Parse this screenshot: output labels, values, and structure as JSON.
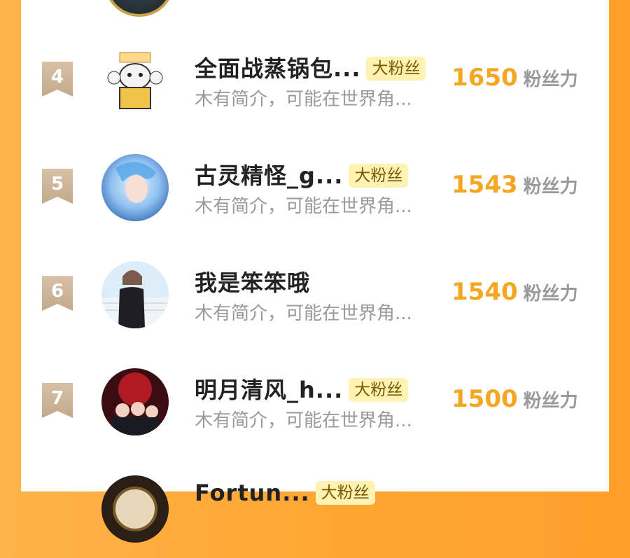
{
  "entries": [
    {
      "rank": "4",
      "name": "全面战蒸锅包...",
      "badge": "大粉丝",
      "desc": "木有简介，可能在世界角...",
      "score": "1650",
      "unit": "粉丝力"
    },
    {
      "rank": "5",
      "name": "古灵精怪_g...",
      "badge": "大粉丝",
      "desc": "木有简介，可能在世界角...",
      "score": "1543",
      "unit": "粉丝力"
    },
    {
      "rank": "6",
      "name": "我是笨笨哦",
      "badge": "",
      "desc": "木有简介，可能在世界角...",
      "score": "1540",
      "unit": "粉丝力"
    },
    {
      "rank": "7",
      "name": "明月清风_h...",
      "badge": "大粉丝",
      "desc": "木有简介，可能在世界角...",
      "score": "1500",
      "unit": "粉丝力"
    },
    {
      "rank": "",
      "name": "Fortun...",
      "badge": "大粉丝",
      "desc": "",
      "score": "",
      "unit": ""
    }
  ],
  "colors": {
    "accent": "#f5a623",
    "badge_bg": "#fff2b3",
    "rank_bg": "#c8ae90"
  }
}
